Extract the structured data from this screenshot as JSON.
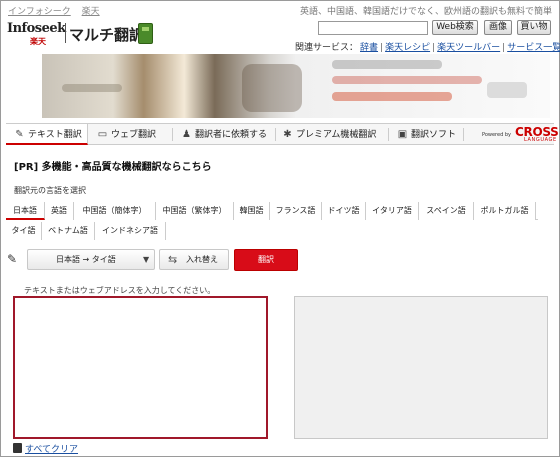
{
  "header": {
    "links": [
      "インフォシーク",
      "楽天"
    ],
    "tagline": "英語、中国語、韓国語だけでなく、欧州語の翻訳も無料で簡単",
    "logo": {
      "brand": "Infoseek",
      "sub": "楽天",
      "title": "マルチ翻訳"
    },
    "search_value": "",
    "buttons": [
      "Web検索",
      "画像",
      "買い物"
    ],
    "related_label": "関連サービス：",
    "related_links": [
      "辞書",
      "楽天レシピ",
      "楽天ツールバー",
      "サービス一覧"
    ]
  },
  "nav": {
    "tabs": [
      {
        "label": "テキスト翻訳",
        "icon": "pencil-icon"
      },
      {
        "label": "ウェブ翻訳",
        "icon": "browser-icon"
      },
      {
        "label": "翻訳者に依頼する",
        "icon": "person-icon"
      },
      {
        "label": "プレミアム機械翻訳",
        "icon": "gear-icon"
      },
      {
        "label": "翻訳ソフト",
        "icon": "box-icon"
      }
    ],
    "powered": "Powered by",
    "cross": "CROSS",
    "language": "LANGUAGE"
  },
  "main": {
    "pr": "[PR] 多機能・高品質な機械翻訳ならこちら",
    "select_label": "翻訳元の言語を選択",
    "languages_row1": [
      "日本語",
      "英語",
      "中国語（簡体字）",
      "中国語（繁体字）",
      "韓国語",
      "フランス語",
      "ドイツ語",
      "イタリア語",
      "スペイン語",
      "ポルトガル語"
    ],
    "languages_row2": [
      "タイ語",
      "ベトナム語",
      "インドネシア語"
    ],
    "pair_from": "日本語",
    "pair_arrow": "→",
    "pair_to": "タイ語",
    "swap_label": "入れ替え",
    "translate_label": "翻訳",
    "hint": "テキストまたはウェブアドレスを入力してください。",
    "source_text": "",
    "clear_label": "すべてクリア"
  },
  "colors": {
    "accent": "#d80c18",
    "link": "#1a4fa0",
    "active_border": "#a0182a"
  }
}
